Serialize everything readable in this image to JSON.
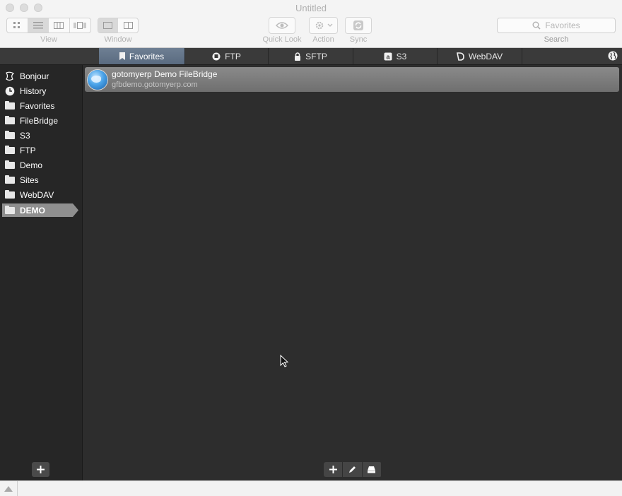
{
  "window": {
    "title": "Untitled"
  },
  "toolbar": {
    "view_label": "View",
    "window_label": "Window",
    "quicklook_label": "Quick Look",
    "action_label": "Action",
    "sync_label": "Sync",
    "search_label": "Search",
    "search_placeholder": "Favorites"
  },
  "tabs": [
    {
      "label": "Favorites",
      "icon": "bookmark-icon",
      "active": true
    },
    {
      "label": "FTP",
      "icon": "ftp-icon",
      "active": false
    },
    {
      "label": "SFTP",
      "icon": "lock-icon",
      "active": false
    },
    {
      "label": "S3",
      "icon": "amazon-s3-icon",
      "active": false
    },
    {
      "label": "WebDAV",
      "icon": "webdav-icon",
      "active": false
    }
  ],
  "sidebar": {
    "items": [
      {
        "label": "Bonjour",
        "icon": "bonjour-icon"
      },
      {
        "label": "History",
        "icon": "clock-icon"
      },
      {
        "label": "Favorites",
        "icon": "folder-icon"
      },
      {
        "label": "FileBridge",
        "icon": "folder-icon"
      },
      {
        "label": "S3",
        "icon": "folder-icon"
      },
      {
        "label": "FTP",
        "icon": "folder-icon"
      },
      {
        "label": "Demo",
        "icon": "folder-icon"
      },
      {
        "label": "Sites",
        "icon": "folder-icon"
      },
      {
        "label": "WebDAV",
        "icon": "folder-icon"
      },
      {
        "label": "DEMO",
        "icon": "folder-icon",
        "selected": true
      }
    ]
  },
  "bookmarks": [
    {
      "name": "gotomyerp Demo FileBridge",
      "host": "gfbdemo.gotomyerp.com"
    }
  ],
  "colors": {
    "selected_tab": "#5f7086",
    "sidebar_bg": "#262626",
    "main_bg": "#2d2d2d",
    "row_selected": "#7c7c7c"
  }
}
